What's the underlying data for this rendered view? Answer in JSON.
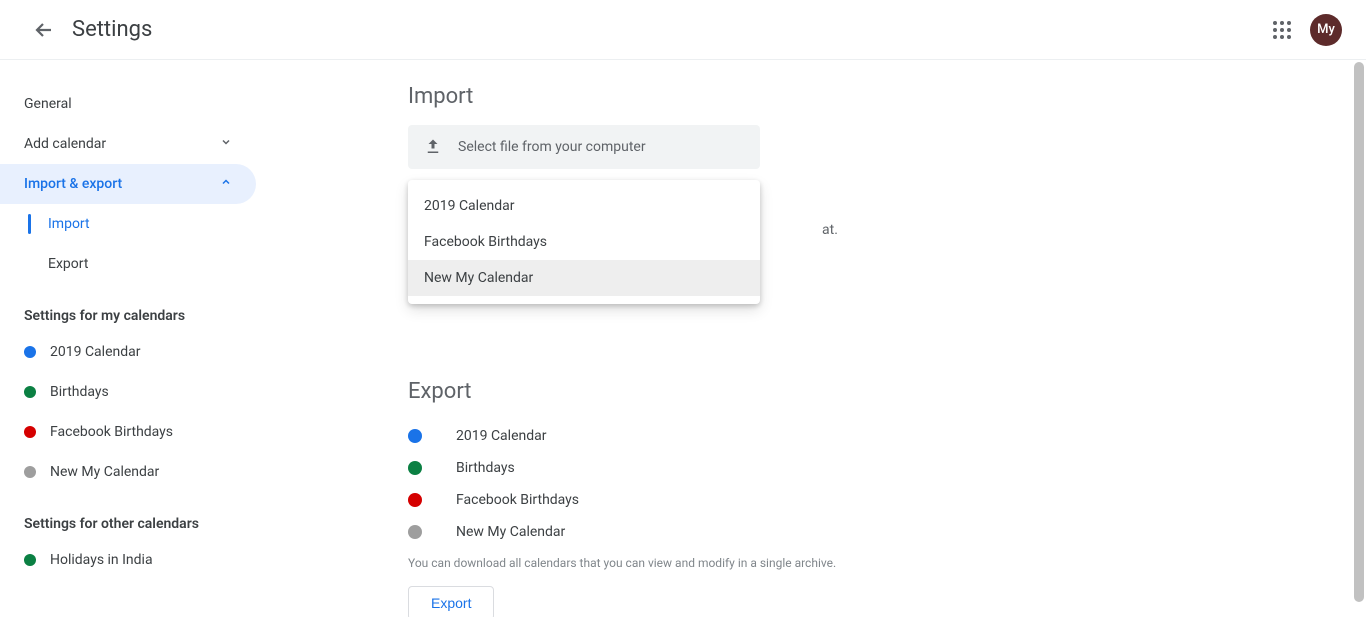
{
  "header": {
    "title": "Settings",
    "avatar_text": "My"
  },
  "sidebar": {
    "general": "General",
    "add_calendar": "Add calendar",
    "import_export": "Import & export",
    "import": "Import",
    "export": "Export",
    "section_my": "Settings for my calendars",
    "my_calendars": [
      {
        "label": "2019 Calendar",
        "color": "#1a73e8"
      },
      {
        "label": "Birthdays",
        "color": "#0b8043"
      },
      {
        "label": "Facebook Birthdays",
        "color": "#d50000"
      },
      {
        "label": "New My Calendar",
        "color": "#9e9e9e"
      }
    ],
    "section_other": "Settings for other calendars",
    "other_calendars": [
      {
        "label": "Holidays in India",
        "color": "#0b8043"
      }
    ]
  },
  "import": {
    "title": "Import",
    "upload_label": "Select file from your computer",
    "hint_suffix": "at.",
    "dropdown_options": [
      "2019 Calendar",
      "Facebook Birthdays",
      "New My Calendar"
    ]
  },
  "export": {
    "title": "Export",
    "calendars": [
      {
        "label": "2019 Calendar",
        "color": "#1a73e8"
      },
      {
        "label": "Birthdays",
        "color": "#0b8043"
      },
      {
        "label": "Facebook Birthdays",
        "color": "#d50000"
      },
      {
        "label": "New My Calendar",
        "color": "#9e9e9e"
      }
    ],
    "caption": "You can download all calendars that you can view and modify in a single archive.",
    "button": "Export"
  }
}
